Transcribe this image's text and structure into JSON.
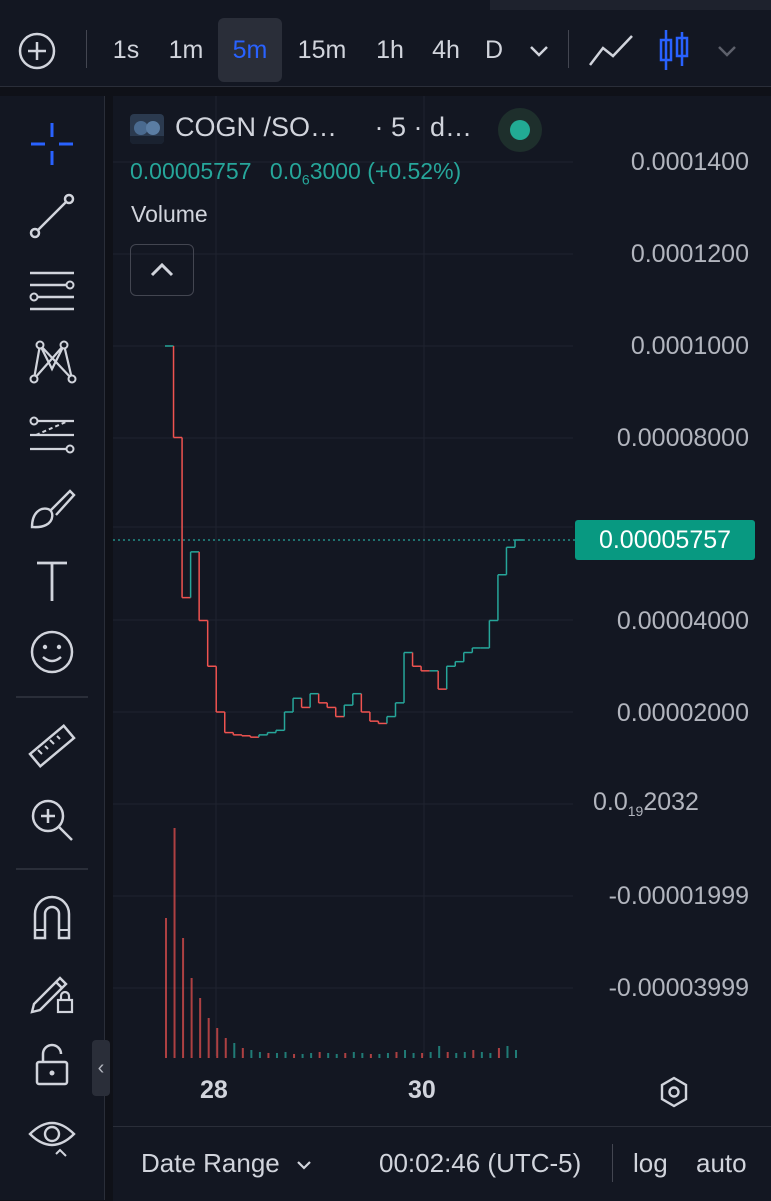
{
  "toolbar_top": {
    "timeframes": [
      "1s",
      "1m",
      "5m",
      "15m",
      "1h",
      "4h",
      "D"
    ],
    "active_timeframe": "5m",
    "icons": [
      "add-circle-icon",
      "chevron-down-icon",
      "line-chart-icon",
      "candlestick-icon",
      "chevron-down-icon"
    ]
  },
  "left_tools": [
    "crosshair-icon",
    "trend-line-icon",
    "fib-lines-icon",
    "pattern-icon",
    "forecast-icon",
    "brush-icon",
    "text-icon",
    "emoji-icon",
    "ruler-icon",
    "zoom-in-icon",
    "magnet-icon",
    "lock-drawing-icon",
    "lock-icon",
    "eye-icon"
  ],
  "legend": {
    "symbol": "COGN /SO…",
    "interval_source": "· 5 · d…",
    "price": "0.00005757",
    "change_prefix": "0.0",
    "change_sub": "6",
    "change_rest": "3000 (+0.52%)",
    "volume_label": "Volume"
  },
  "price_axis": {
    "labels": [
      "0.0001400",
      "0.0001200",
      "0.0001000",
      "0.00008000",
      "0.00004000",
      "0.00002000",
      "-0.00001999",
      "-0.00003999"
    ],
    "zero_label_prefix": "0.0",
    "zero_label_sub": "19",
    "zero_label_rest": "2032",
    "last_price": "0.00005757"
  },
  "time_axis": {
    "labels": [
      "28",
      "30"
    ]
  },
  "bottom_bar": {
    "date_range": "Date Range",
    "clock": "00:02:46 (UTC-5)",
    "log": "log",
    "auto": "auto"
  },
  "colors": {
    "up": "#26a69a",
    "down": "#ef5350",
    "last_price_bg": "#089981",
    "accent": "#2962ff"
  },
  "chart_data": {
    "type": "candlestick",
    "xlabel": "",
    "ylabel": "",
    "ylim": [
      -4e-05,
      0.00015
    ],
    "x_ticks": [
      "28",
      "30"
    ],
    "price_path": [
      0.0001,
      8e-05,
      4.5e-05,
      5.5e-05,
      4e-05,
      3e-05,
      2e-05,
      1.55e-05,
      1.5e-05,
      1.48e-05,
      1.45e-05,
      1.5e-05,
      1.55e-05,
      1.6e-05,
      2e-05,
      2.3e-05,
      2.1e-05,
      2.4e-05,
      2.2e-05,
      2.1e-05,
      1.9e-05,
      2.15e-05,
      2.4e-05,
      2e-05,
      1.8e-05,
      1.75e-05,
      1.9e-05,
      2.2e-05,
      3.3e-05,
      3e-05,
      2.9e-05,
      2.9e-05,
      2.5e-05,
      3e-05,
      3.1e-05,
      3.3e-05,
      3.4e-05,
      3.4e-05,
      4e-05,
      5e-05,
      5.6e-05,
      5.76e-05
    ],
    "volume_note": "volume bars near bottom; largest spike at start"
  }
}
